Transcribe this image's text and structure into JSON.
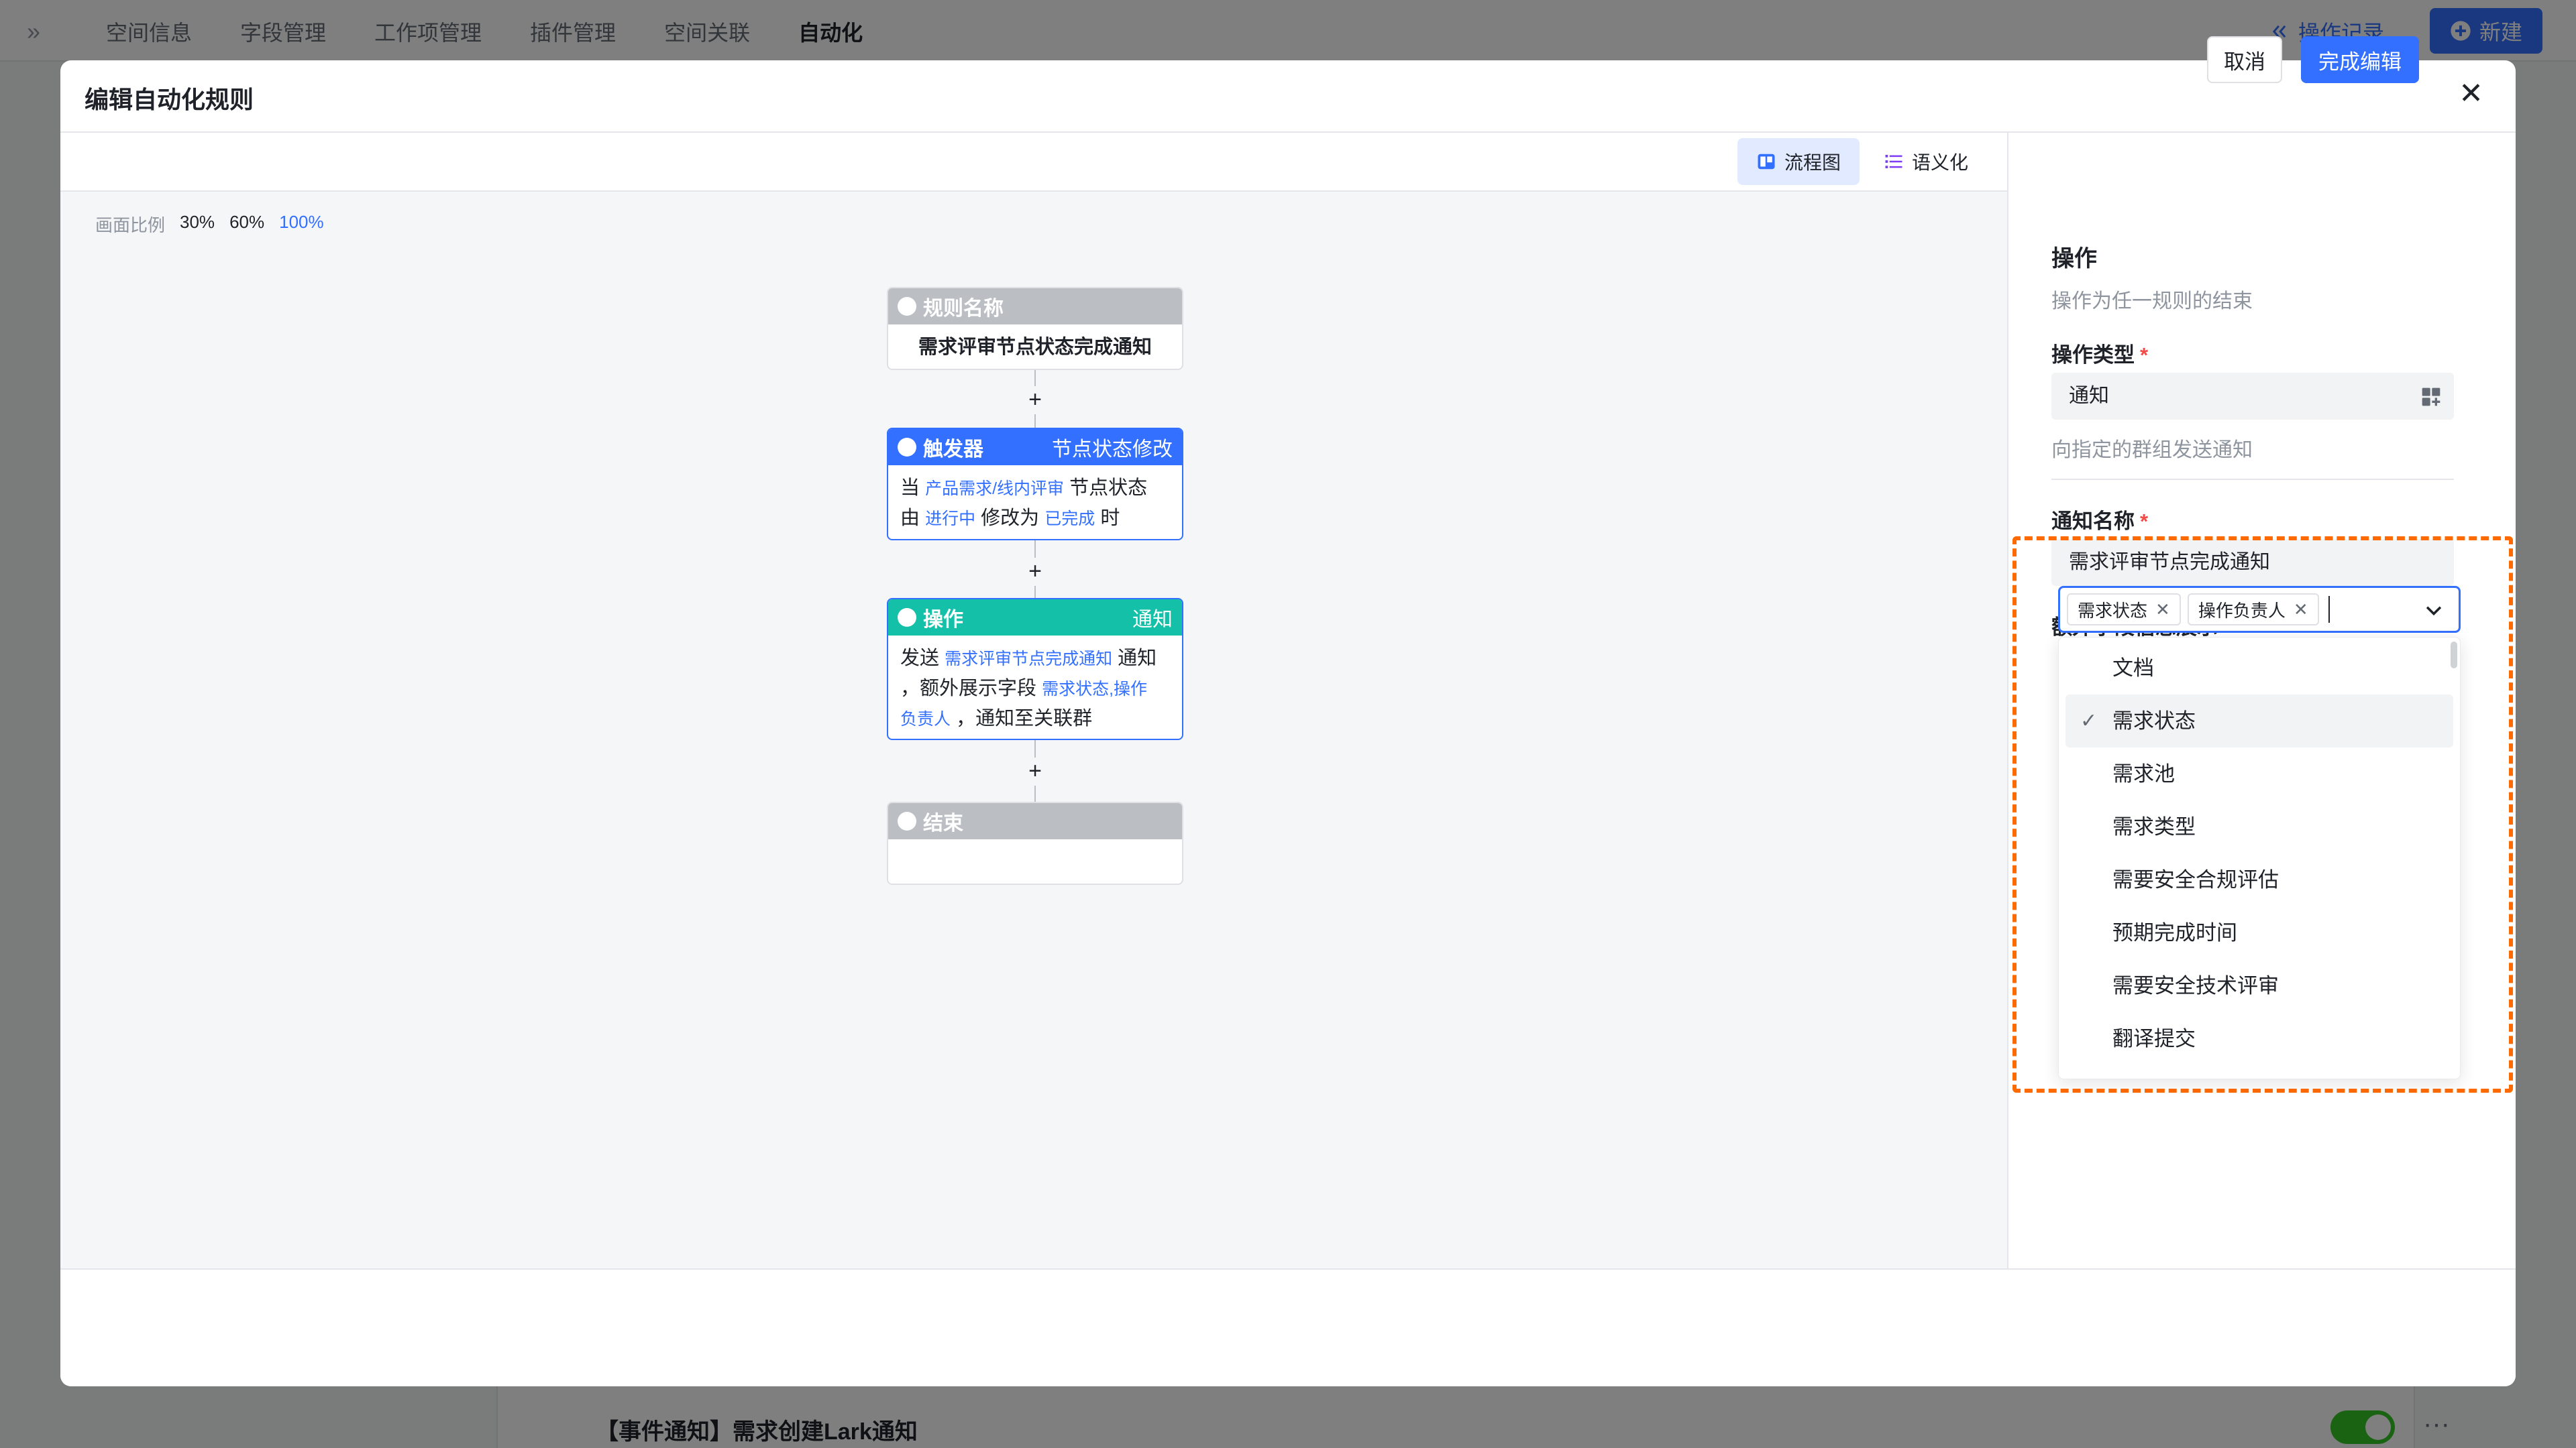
{
  "app": {
    "expand_icon": "»",
    "tabs": [
      "空间信息",
      "字段管理",
      "工作项管理",
      "插件管理",
      "空间关联",
      "自动化"
    ],
    "active_tab": "自动化",
    "oplog_label": "操作记录",
    "new_label": "新建",
    "bg_row_title": "【事件通知】需求创建Lark通知"
  },
  "modal": {
    "title": "编辑自动化规则",
    "close_icon": "✕"
  },
  "views": {
    "flow_label": "流程图",
    "semantic_label": "语义化"
  },
  "zoom": {
    "label": "画面比例",
    "options": [
      "30%",
      "60%",
      "100%"
    ],
    "active": "100%"
  },
  "flow": {
    "rule_node": {
      "head": "规则名称",
      "body": "需求评审节点状态完成通知"
    },
    "trigger_node": {
      "head": "触发器",
      "tag": "节点状态修改",
      "t1": "当",
      "v1": "产品需求/线内评审",
      "t2": "节点状态",
      "t3": "由",
      "v2": "进行中",
      "t4": "修改为",
      "v3": "已完成",
      "t5": "时"
    },
    "action_node": {
      "head": "操作",
      "tag": "通知",
      "t1": "发送",
      "v1": "需求评审节点完成通知",
      "t2": "通知",
      "t3": "，额外展示字段",
      "v2": "需求状态,操作",
      "v3": "负责人",
      "t4": "，通知至关联群"
    },
    "end_node": {
      "head": "结束"
    },
    "plus": "+"
  },
  "panel": {
    "title": "操作",
    "subtitle": "操作为任一规则的结束",
    "op_type_label": "操作类型",
    "op_type_value": "通知",
    "op_type_hint": "向指定的群组发送通知",
    "notify_name_label": "通知名称",
    "notify_name_value": "需求评审节点完成通知",
    "extra_fields_label": "额外字段信息展示",
    "required_mark": "*",
    "selected_tags": [
      "需求状态",
      "操作负责人"
    ],
    "tag_remove": "✕",
    "options": [
      "文档",
      "需求状态",
      "需求池",
      "需求类型",
      "需要安全合规评估",
      "预期完成时间",
      "需要安全技术评审",
      "翻译提交"
    ],
    "checked_option": "需求状态",
    "check_mark": "✓"
  },
  "footer": {
    "cancel_label": "取消",
    "done_label": "完成编辑"
  }
}
